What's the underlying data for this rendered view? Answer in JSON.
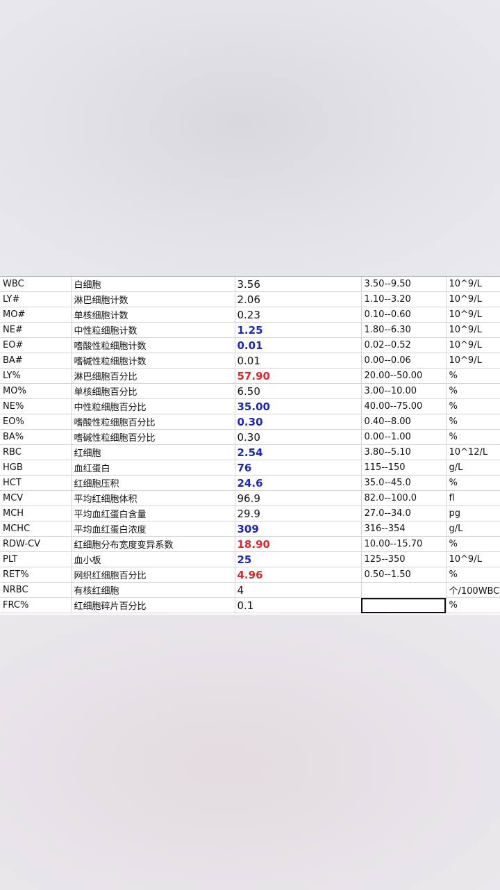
{
  "rows": [
    {
      "code": "WBC",
      "name": "白细胞",
      "value": "3.56",
      "flag": "",
      "range": "3.50--9.50",
      "unit": "10^9/L"
    },
    {
      "code": "LY#",
      "name": "淋巴细胞计数",
      "value": "2.06",
      "flag": "",
      "range": "1.10--3.20",
      "unit": "10^9/L"
    },
    {
      "code": "MO#",
      "name": "单核细胞计数",
      "value": "0.23",
      "flag": "",
      "range": "0.10--0.60",
      "unit": "10^9/L"
    },
    {
      "code": "NE#",
      "name": "中性粒细胞计数",
      "value": "1.25",
      "flag": "low",
      "range": "1.80--6.30",
      "unit": "10^9/L"
    },
    {
      "code": "EO#",
      "name": "嗜酸性粒细胞计数",
      "value": "0.01",
      "flag": "low",
      "range": "0.02--0.52",
      "unit": "10^9/L"
    },
    {
      "code": "BA#",
      "name": "嗜碱性粒细胞计数",
      "value": "0.01",
      "flag": "",
      "range": "0.00--0.06",
      "unit": "10^9/L"
    },
    {
      "code": "LY%",
      "name": "淋巴细胞百分比",
      "value": "57.90",
      "flag": "high",
      "range": "20.00--50.00",
      "unit": "%"
    },
    {
      "code": "MO%",
      "name": "单核细胞百分比",
      "value": "6.50",
      "flag": "",
      "range": "3.00--10.00",
      "unit": "%"
    },
    {
      "code": "NE%",
      "name": "中性粒细胞百分比",
      "value": "35.00",
      "flag": "low",
      "range": "40.00--75.00",
      "unit": "%"
    },
    {
      "code": "EO%",
      "name": "嗜酸性粒细胞百分比",
      "value": "0.30",
      "flag": "low",
      "range": "0.40--8.00",
      "unit": "%"
    },
    {
      "code": "BA%",
      "name": "嗜碱性粒细胞百分比",
      "value": "0.30",
      "flag": "",
      "range": "0.00--1.00",
      "unit": "%"
    },
    {
      "code": "RBC",
      "name": "红细胞",
      "value": "2.54",
      "flag": "low",
      "range": "3.80--5.10",
      "unit": "10^12/L"
    },
    {
      "code": "HGB",
      "name": "血红蛋白",
      "value": "76",
      "flag": "low",
      "range": "115--150",
      "unit": "g/L"
    },
    {
      "code": "HCT",
      "name": "红细胞压积",
      "value": "24.6",
      "flag": "low",
      "range": "35.0--45.0",
      "unit": "%"
    },
    {
      "code": "MCV",
      "name": "平均红细胞体积",
      "value": "96.9",
      "flag": "",
      "range": "82.0--100.0",
      "unit": "fl"
    },
    {
      "code": "MCH",
      "name": "平均血红蛋白含量",
      "value": "29.9",
      "flag": "",
      "range": "27.0--34.0",
      "unit": "pg"
    },
    {
      "code": "MCHC",
      "name": "平均血红蛋白浓度",
      "value": "309",
      "flag": "low",
      "range": "316--354",
      "unit": "g/L"
    },
    {
      "code": "RDW-CV",
      "name": "红细胞分布宽度变异系数",
      "value": "18.90",
      "flag": "high",
      "range": "10.00--15.70",
      "unit": "%"
    },
    {
      "code": "PLT",
      "name": "血小板",
      "value": "25",
      "flag": "low",
      "range": "125--350",
      "unit": "10^9/L"
    },
    {
      "code": "RET%",
      "name": "网织红细胞百分比",
      "value": "4.96",
      "flag": "high",
      "range": "0.50--1.50",
      "unit": "%"
    },
    {
      "code": "NRBC",
      "name": "有核红细胞",
      "value": "4",
      "flag": "",
      "range": "",
      "unit": "个/100WBC"
    },
    {
      "code": "FRC%",
      "name": "红细胞碎片百分比",
      "value": "0.1",
      "flag": "",
      "range": "",
      "unit": "%"
    }
  ],
  "colors": {
    "low": "#1a25c2",
    "high": "#e0252a"
  }
}
